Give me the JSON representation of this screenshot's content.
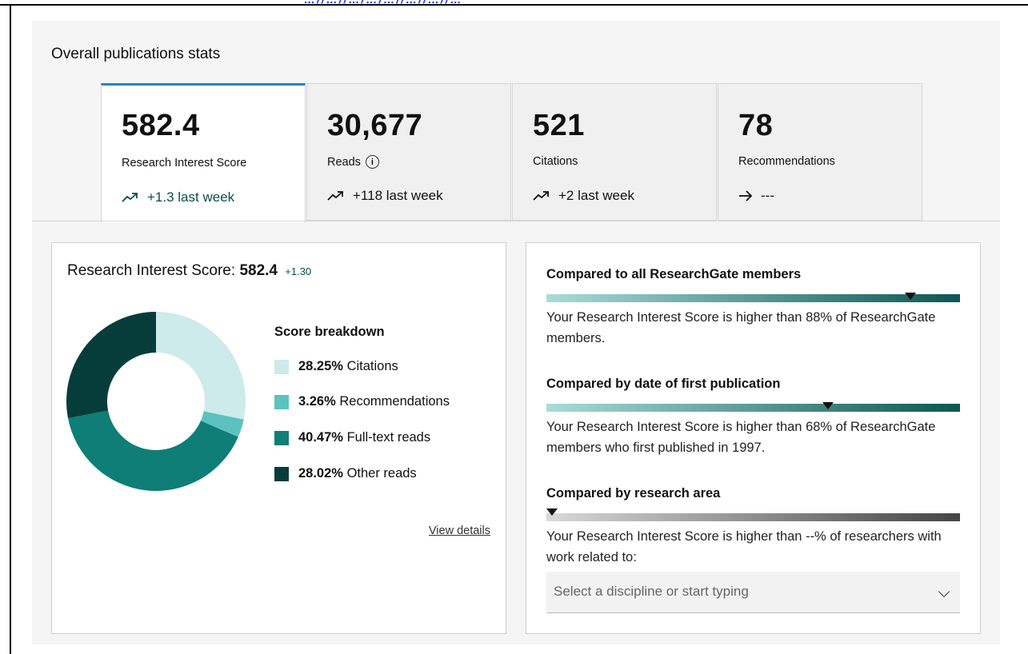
{
  "page_title": "Overall publications stats",
  "clipped_header_text": "…//…//…/…/…//…//…//…",
  "stats_tabs": [
    {
      "value": "582.4",
      "label": "Research Interest Score",
      "trend_icon": "trend-up-icon",
      "trend": "+1.3 last week",
      "active": true
    },
    {
      "value": "30,677",
      "label": "Reads",
      "info_icon": "info-icon",
      "trend_icon": "trend-up-icon",
      "trend": "+118 last week"
    },
    {
      "value": "521",
      "label": "Citations",
      "trend_icon": "trend-up-icon",
      "trend": "+2 last week"
    },
    {
      "value": "78",
      "label": "Recommendations",
      "trend_icon": "arrow-right-icon",
      "trend": "---"
    }
  ],
  "score_card": {
    "title_prefix": "Research Interest Score:",
    "title_value": "582.4",
    "title_delta": "+1.30",
    "breakdown_title": "Score breakdown",
    "view_details": "View details"
  },
  "chart_data": {
    "type": "pie",
    "donut": true,
    "title": "Score breakdown",
    "series": [
      {
        "name": "Citations",
        "percent": 28.25,
        "label_value": "28.25%",
        "label_text": "Citations",
        "color": "#cdebea"
      },
      {
        "name": "Recommendations",
        "percent": 3.26,
        "label_value": "3.26%",
        "label_text": "Recommendations",
        "color": "#5bc2bf"
      },
      {
        "name": "Full-text reads",
        "percent": 40.47,
        "label_value": "40.47%",
        "label_text": "Full-text reads",
        "color": "#0f7e76"
      },
      {
        "name": "Other reads",
        "percent": 28.02,
        "label_value": "28.02%",
        "label_text": "Other reads",
        "color": "#063d3b"
      }
    ]
  },
  "comparisons": [
    {
      "title": "Compared to all ResearchGate members",
      "percentile": 88,
      "text": "Your Research Interest Score is higher than 88% of ResearchGate members.",
      "gradient": [
        "#a8dcd9",
        "#0b5753"
      ]
    },
    {
      "title": "Compared by date of first publication",
      "percentile": 68,
      "text": "Your Research Interest Score is higher than 68% of ResearchGate members who first published in 1997.",
      "gradient": [
        "#a8dcd9",
        "#0b5753"
      ]
    },
    {
      "title": "Compared by research area",
      "percentile": 0,
      "text": "Your Research Interest Score is higher than --% of researchers with work related to:",
      "gradient": [
        "#d9d9d9",
        "#444444"
      ]
    }
  ],
  "discipline_select": {
    "placeholder": "Select a discipline or start typing",
    "icon": "chevron-down-icon"
  },
  "colors": {
    "accent": "#2c7ec8",
    "teal_dark": "#0b4f4a"
  }
}
